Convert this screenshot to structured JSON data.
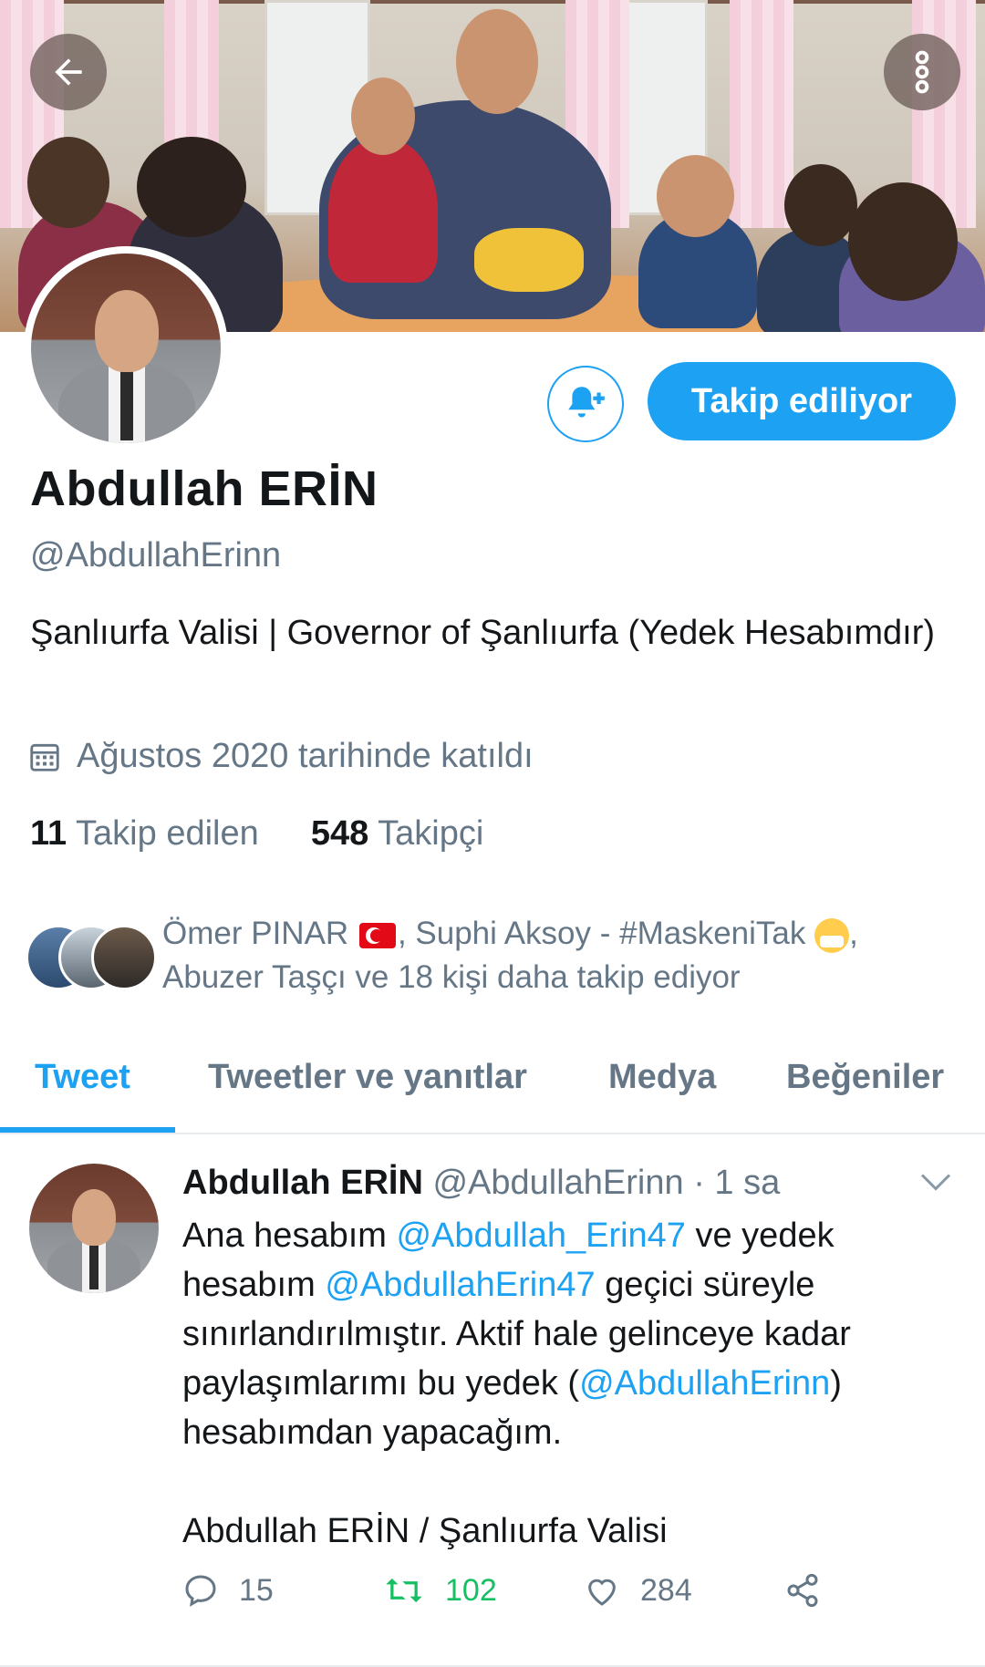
{
  "profile": {
    "name": "Abdullah ERİN",
    "handle": "@AbdullahErinn",
    "bio": "Şanlıurfa Valisi | Governor of Şanlıurfa (Yedek Hesabımdır)",
    "joined": "Ağustos 2020 tarihinde katıldı",
    "following_count": "11",
    "following_label": "Takip edilen",
    "followers_count": "548",
    "followers_label": "Takipçi"
  },
  "actions": {
    "follow_label": "Takip ediliyor"
  },
  "known_followers": {
    "part1": "Ömer PINAR",
    "part2": ", Suphi Aksoy - #MaskeniTak",
    "part3": ",",
    "part4": "Abuzer Taşçı ve 18 kişi daha takip ediyor"
  },
  "tabs": [
    {
      "label": "Tweet"
    },
    {
      "label": "Tweetler ve yanıtlar"
    },
    {
      "label": "Medya"
    },
    {
      "label": "Beğeniler"
    }
  ],
  "tweet": {
    "author_name": "Abdullah ERİN",
    "author_handle": "@AbdullahErinn",
    "time": "· 1 sa",
    "text_1": "Ana hesabım ",
    "mention_1": "@Abdullah_Erin47",
    "text_2": " ve yedek hesabım ",
    "mention_2": "@AbdullahErin47",
    "text_3": " geçici süreyle sınırlandırılmıştır. Aktif hale gelinceye kadar paylaşımlarımı bu yedek (",
    "mention_3": "@AbdullahErinn",
    "text_4": ") hesabımdan yapacağım.",
    "signature": "Abdullah ERİN / Şanlıurfa Valisi",
    "replies": "15",
    "retweets": "102",
    "likes": "284"
  },
  "colors": {
    "accent": "#1da1f2",
    "retweet": "#17bf63",
    "muted": "#657786"
  },
  "icons": [
    "back-arrow-icon",
    "more-vertical-icon",
    "bell-plus-icon",
    "calendar-icon",
    "chevron-down-icon",
    "reply-icon",
    "retweet-icon",
    "like-icon",
    "share-icon"
  ]
}
